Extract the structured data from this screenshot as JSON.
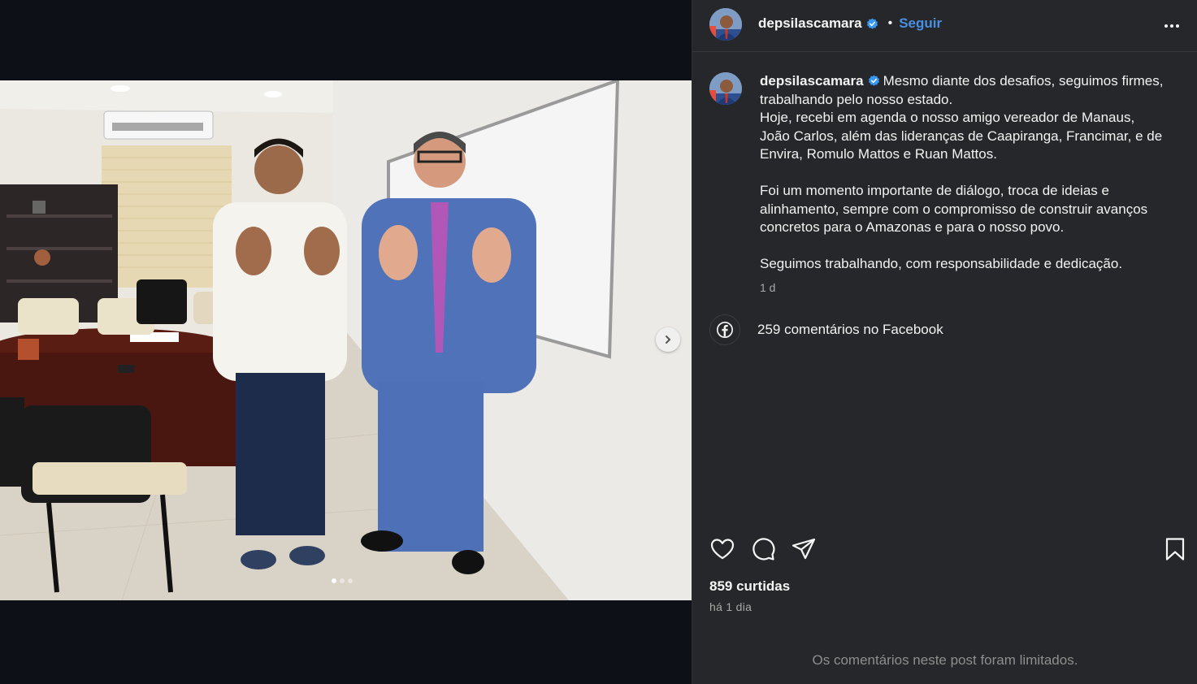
{
  "post": {
    "username": "depsilascamara",
    "follow_label": "Seguir",
    "caption_lines_1": [
      "Mesmo diante dos desafios, seguimos firmes,",
      "trabalhando pelo nosso estado.",
      "Hoje, recebi em agenda o nosso amigo vereador de Manaus,",
      "João Carlos, além das lideranças de Caapiranga, Francimar, e de",
      "Envira, Romulo Mattos e Ruan Mattos."
    ],
    "caption_lines_2": [
      "Foi um momento importante de diálogo, troca de ideias e",
      "alinhamento, sempre com o compromisso de construir avanços",
      "concretos para o Amazonas e para o nosso povo."
    ],
    "caption_lines_3": [
      "Seguimos trabalhando, com responsabilidade e dedicação."
    ],
    "caption_time": "1 d",
    "facebook_comments": "259 comentários no Facebook",
    "likes": "859 curtidas",
    "posted_when": "há 1 dia",
    "comments_limited": "Os comentários neste post foram limitados."
  },
  "carousel": {
    "total_slides": 3,
    "active_slide": 1
  },
  "icons": {
    "verified": "verified-badge-icon",
    "more": "more-options-icon",
    "facebook": "facebook-icon",
    "like": "heart-icon",
    "comment": "comment-icon",
    "share": "share-icon",
    "save": "bookmark-icon",
    "next": "chevron-right-icon"
  },
  "colors": {
    "accent": "#4a90e2",
    "sidebar_bg": "#25272a",
    "page_bg": "#0d1117"
  }
}
